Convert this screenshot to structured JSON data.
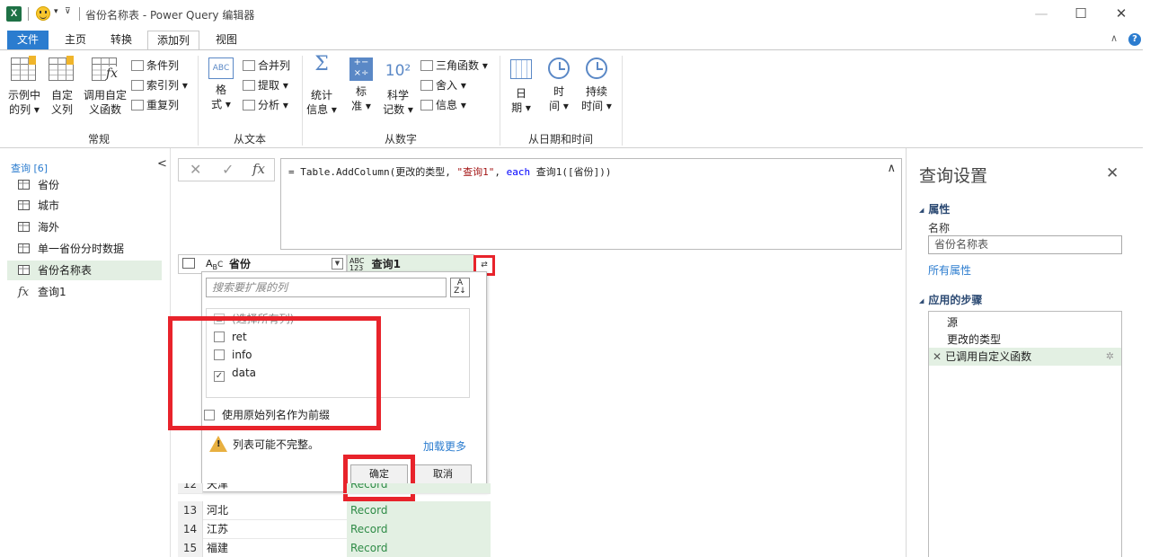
{
  "window": {
    "title": "省份名称表 - Power Query 编辑器",
    "logo_text": "X",
    "minimize": "—",
    "maximize": "☐",
    "close": "✕"
  },
  "tabs": [
    "文件",
    "主页",
    "转换",
    "添加列",
    "视图"
  ],
  "active_tab": "添加列",
  "ribbon": {
    "general": {
      "label": "常规",
      "example_col": [
        "示例中",
        "的列 ▾"
      ],
      "custom_col": [
        "自定",
        "义列"
      ],
      "invoke_fn": [
        "调用自定",
        "义函数"
      ],
      "conditional": "条件列",
      "index": "索引列 ▾",
      "duplicate": "重复列"
    },
    "from_text": {
      "label": "从文本",
      "format": [
        "格",
        "式 ▾"
      ],
      "merge": "合并列",
      "extract": "提取 ▾",
      "parse": "分析 ▾"
    },
    "from_number": {
      "label": "从数字",
      "stats": [
        "统计",
        "信息 ▾"
      ],
      "standard": [
        "标",
        "准 ▾"
      ],
      "scientific": [
        "科学",
        "记数 ▾"
      ],
      "trig": "三角函数 ▾",
      "round": "舍入 ▾",
      "info": "信息 ▾"
    },
    "from_datetime": {
      "label": "从日期和时间",
      "date": [
        "日",
        "期 ▾"
      ],
      "time": [
        "时",
        "间 ▾"
      ],
      "duration": [
        "持续",
        "时间 ▾"
      ]
    }
  },
  "queries": {
    "header": "查询 [6]",
    "collapse": "<",
    "items": [
      {
        "name": "省份",
        "type": "table"
      },
      {
        "name": "城市",
        "type": "table"
      },
      {
        "name": "海外",
        "type": "table"
      },
      {
        "name": "单一省份分时数据",
        "type": "table"
      },
      {
        "name": "省份名称表",
        "type": "table"
      },
      {
        "name": "查询1",
        "type": "function"
      }
    ],
    "selected": "省份名称表"
  },
  "formula": {
    "cancel": "✕",
    "confirm": "✓",
    "fx": "fx",
    "prefix": "= Table.AddColumn(更改的类型, ",
    "str1": "\"查询1\"",
    "mid": ", ",
    "kw": "each",
    "suffix": " 查询1([省份]))",
    "expand": "∧"
  },
  "columns": {
    "col1": "省份",
    "col2": "查询1",
    "abc_top": "ABC",
    "abc_bottom": "123",
    "ac_a": "A",
    "ac_b": "B",
    "ac_c": "C"
  },
  "expand_popup": {
    "search_placeholder": "搜索要扩展的列",
    "select_all": "(选择所有列)",
    "fields": [
      {
        "name": "ret",
        "checked": false
      },
      {
        "name": "info",
        "checked": false
      },
      {
        "name": "data",
        "checked": true
      }
    ],
    "prefix_label": "使用原始列名作为前缀",
    "warning": "列表可能不完整。",
    "load_more": "加载更多",
    "ok": "确定",
    "cancel": "取消"
  },
  "rows": [
    {
      "num": "12",
      "prov": "天津",
      "val": "Record"
    },
    {
      "num": "13",
      "prov": "河北",
      "val": "Record"
    },
    {
      "num": "14",
      "prov": "江苏",
      "val": "Record"
    },
    {
      "num": "15",
      "prov": "福建",
      "val": "Record"
    }
  ],
  "settings": {
    "title": "查询设置",
    "close": "✕",
    "props_header": "属性",
    "name_label": "名称",
    "name_value": "省份名称表",
    "all_props": "所有属性",
    "steps_header": "应用的步骤",
    "steps": [
      "源",
      "更改的类型",
      "已调用自定义函数"
    ],
    "selected_step": "已调用自定义函数"
  },
  "colors": {
    "accent": "#2b7ccf",
    "highlight_red": "#e8232b",
    "selected_green": "#e3f0e3",
    "record_text": "#2e8b46"
  }
}
